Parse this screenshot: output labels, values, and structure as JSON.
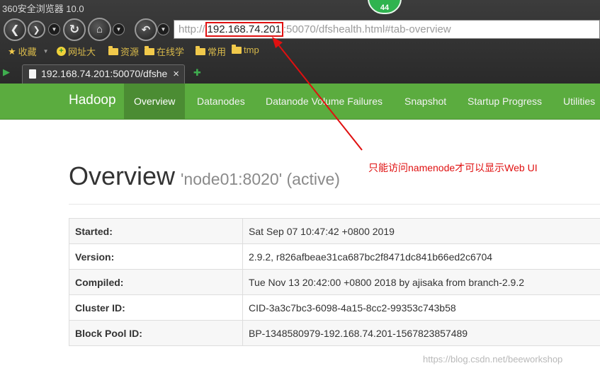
{
  "browser": {
    "title": "360安全浏览器 10.0",
    "badge_count": "44",
    "address": {
      "prefix": "http://",
      "host": "192.168.74.201",
      "rest": ":50070/dfshealth.html#tab-overview"
    },
    "bookmarks": [
      "收藏",
      "网址大",
      "资源",
      "在线学",
      "常用",
      "tmp"
    ],
    "tab": {
      "title": "192.168.74.201:50070/dfshe",
      "close": "×"
    }
  },
  "hadoop_nav": {
    "brand": "Hadoop",
    "items": [
      "Overview",
      "Datanodes",
      "Datanode Volume Failures",
      "Snapshot",
      "Startup Progress",
      "Utilities"
    ]
  },
  "overview": {
    "title": "Overview",
    "subtitle": "'node01:8020' (active)",
    "rows": [
      {
        "label": "Started:",
        "value": "Sat Sep 07 10:47:42 +0800 2019"
      },
      {
        "label": "Version:",
        "value": "2.9.2, r826afbeae31ca687bc2f8471dc841b66ed2c6704"
      },
      {
        "label": "Compiled:",
        "value": "Tue Nov 13 20:42:00 +0800 2018 by ajisaka from branch-2.9.2"
      },
      {
        "label": "Cluster ID:",
        "value": "CID-3a3c7bc3-6098-4a15-8cc2-99353c743b58"
      },
      {
        "label": "Block Pool ID:",
        "value": "BP-1348580979-192.168.74.201-1567823857489"
      }
    ]
  },
  "annotation": "只能访问namenode才可以显示Web UI",
  "watermark": "https://blog.csdn.net/beeworkshop",
  "colors": {
    "nav_green": "#5bac3f",
    "nav_active": "#4b8c33",
    "annotation_red": "#e01010"
  }
}
